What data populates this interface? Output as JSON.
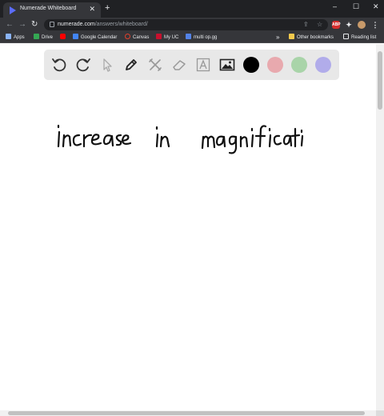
{
  "browser": {
    "tab_title": "Numerade Whiteboard",
    "tab_close": "✕",
    "new_tab": "+",
    "window_controls": [
      "–",
      "☐",
      "✕"
    ],
    "url_host": "numerade.com",
    "url_path": "/answers/whiteboard/",
    "extension_badge": "ABP"
  },
  "bookmarks": [
    {
      "label": "Apps",
      "icon": "apps-grid-icon",
      "color": "#8ab4f8"
    },
    {
      "label": "Drive",
      "icon": "google-drive-icon",
      "color": "#34a853"
    },
    {
      "label": "",
      "icon": "youtube-icon",
      "color": "#ff0000"
    },
    {
      "label": "Google Calendar",
      "icon": "google-calendar-icon",
      "color": "#4285f4"
    },
    {
      "label": "Canvas",
      "icon": "canvas-icon",
      "color": "#e13f2b"
    },
    {
      "label": "My UC",
      "icon": "uc-icon",
      "color": "#c8102e"
    },
    {
      "label": "multi op.gg",
      "icon": "opgg-icon",
      "color": "#5383e8"
    }
  ],
  "bookmarks_overflow": "»",
  "other_bookmarks": "Other bookmarks",
  "reading_list": "Reading list",
  "toolbar": {
    "tools": [
      "undo-icon",
      "redo-icon",
      "pointer-icon",
      "pen-icon",
      "tools-icon",
      "eraser-icon",
      "text-icon",
      "image-icon"
    ],
    "colors": [
      "#000000",
      "#e8a9ae",
      "#a9d4a9",
      "#b1acea"
    ]
  }
}
